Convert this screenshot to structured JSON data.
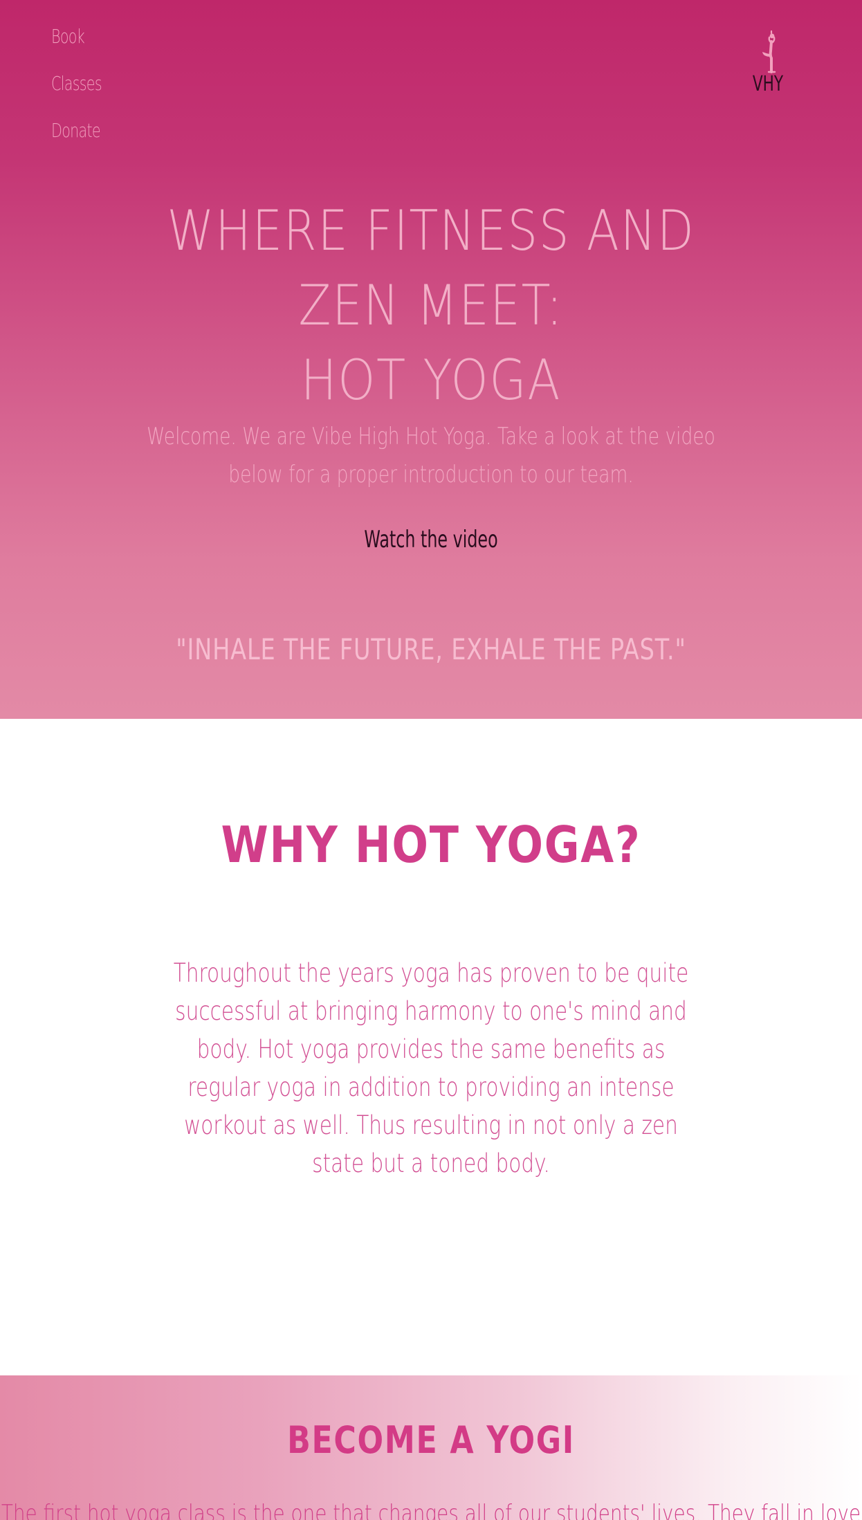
{
  "nav": {
    "items": [
      {
        "label": "Book"
      },
      {
        "label": "Classes"
      },
      {
        "label": "Donate"
      }
    ]
  },
  "logo": {
    "text": "VHY",
    "icon": "yoga-tree-pose-icon"
  },
  "hero": {
    "title_line1": "WHERE FITNESS AND ZEN MEET:",
    "title_line2": "HOT YOGA",
    "welcome": "Welcome. We are Vibe High Hot Yoga. Take a look at the video below for a proper introduction to our team.",
    "watch_label": "Watch the video",
    "quote": "\"INHALE THE FUTURE, EXHALE THE PAST.\""
  },
  "why": {
    "title": "WHY HOT YOGA?",
    "text": "Throughout the years yoga has proven to be quite successful at bringing harmony to one's mind and body. Hot yoga provides the same benefits as regular yoga in addition to providing an intense workout as well. Thus resulting in not only a zen state but a toned body."
  },
  "yogi": {
    "title": "BECOME A YOGI",
    "text": "The first hot yoga class is the one that changes all of our students' lives. They fall in love"
  },
  "colors": {
    "hero_top": "#bf276a",
    "hero_bottom": "#e38aa6",
    "accent": "#d13e8a",
    "dark": "#2a0d1e"
  }
}
